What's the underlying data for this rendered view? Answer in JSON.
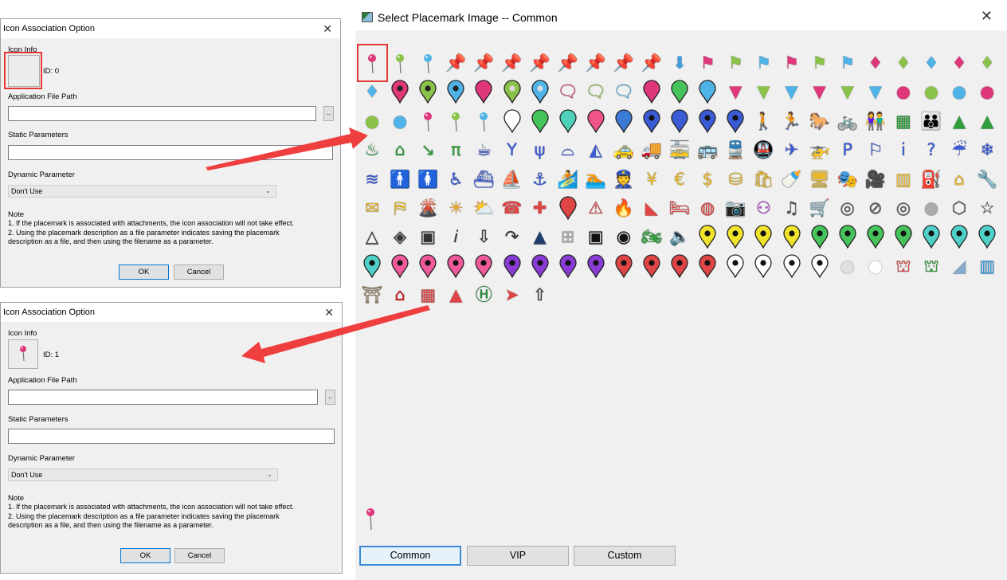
{
  "dialog_top": {
    "title": "Icon Association Option",
    "icon_info_label": "Icon Info",
    "id_text": "ID: 0",
    "app_path_label": "Application File Path",
    "browse_label": "..",
    "static_params_label": "Static Parameters",
    "dynamic_param_label": "Dynamic Parameter",
    "dynamic_param_value": "Don't Use",
    "note_title": "Note",
    "note_text": "1. If the placemark is associated with attachments, the icon association will not take effect.\n2. Using the placemark description as a file parameter indicates saving the placemark\ndescription as a file, and then using the filename as a parameter.",
    "ok_label": "OK",
    "cancel_label": "Cancel"
  },
  "dialog_bottom": {
    "title": "Icon Association Option",
    "icon_info_label": "Icon Info",
    "id_text": "ID: 1",
    "app_path_label": "Application File Path",
    "browse_label": "..",
    "static_params_label": "Static Parameters",
    "dynamic_param_label": "Dynamic Parameter",
    "dynamic_param_value": "Don't Use",
    "note_title": "Note",
    "note_text": "1. If the placemark is associated with attachments, the icon association will not take effect.\n2. Using the placemark description as a file parameter indicates saving the placemark\ndescription as a file, and then using the filename as a parameter.",
    "ok_label": "OK",
    "cancel_label": "Cancel"
  },
  "picker": {
    "title": "Select Placemark Image -- Common",
    "tabs": [
      {
        "label": "Common",
        "active": true
      },
      {
        "label": "VIP",
        "active": false
      },
      {
        "label": "Custom",
        "active": false
      }
    ],
    "icons": [
      {
        "kind": "pin",
        "color": "#e0367a"
      },
      {
        "kind": "pin",
        "color": "#8bc34a"
      },
      {
        "kind": "pin",
        "color": "#4fb3e8"
      },
      {
        "kind": "glyph",
        "glyph": "📌",
        "color": "#e8e02a"
      },
      {
        "kind": "glyph",
        "glyph": "📌",
        "color": "#3b5bd6"
      },
      {
        "kind": "glyph",
        "glyph": "📌",
        "color": "#46c35a"
      },
      {
        "kind": "glyph",
        "glyph": "📌",
        "color": "#2cc0b9"
      },
      {
        "kind": "glyph",
        "glyph": "📌",
        "color": "#d13a8f"
      },
      {
        "kind": "glyph",
        "glyph": "📌",
        "color": "#8a3bd6"
      },
      {
        "kind": "glyph",
        "glyph": "📌",
        "color": "#e04545"
      },
      {
        "kind": "glyph",
        "glyph": "📌",
        "color": "#dddddd"
      },
      {
        "kind": "glyph",
        "glyph": "⬇",
        "color": "#3aa0e0"
      },
      {
        "kind": "glyph",
        "glyph": "⚑",
        "color": "#e0367a"
      },
      {
        "kind": "glyph",
        "glyph": "⚑",
        "color": "#8bc34a"
      },
      {
        "kind": "glyph",
        "glyph": "⚑",
        "color": "#4fb3e8"
      },
      {
        "kind": "glyph",
        "glyph": "⚑",
        "color": "#e0367a"
      },
      {
        "kind": "glyph",
        "glyph": "⚑",
        "color": "#8bc34a"
      },
      {
        "kind": "glyph",
        "glyph": "⚑",
        "color": "#4fb3e8"
      },
      {
        "kind": "glyph",
        "glyph": "♦",
        "color": "#e0367a"
      },
      {
        "kind": "glyph",
        "glyph": "♦",
        "color": "#8bc34a"
      },
      {
        "kind": "glyph",
        "glyph": "♦",
        "color": "#4fb3e8"
      },
      {
        "kind": "glyph",
        "glyph": "♦",
        "color": "#e0367a"
      },
      {
        "kind": "glyph",
        "glyph": "♦",
        "color": "#8bc34a"
      },
      {
        "kind": "glyph",
        "glyph": "♦",
        "color": "#4fb3e8"
      },
      {
        "kind": "balloon",
        "color": "#e0367a",
        "dot": "#222"
      },
      {
        "kind": "balloon",
        "color": "#8bc34a",
        "dot": "#222"
      },
      {
        "kind": "balloon",
        "color": "#4fb3e8",
        "dot": "#222"
      },
      {
        "kind": "balloon",
        "color": "#e0367a",
        "dot": "#e0367a"
      },
      {
        "kind": "balloon",
        "color": "#8bc34a",
        "dot": "#ddd"
      },
      {
        "kind": "balloon",
        "color": "#4fb3e8",
        "dot": "#ddd"
      },
      {
        "kind": "glyph",
        "glyph": "🗨",
        "color": "#e0367a"
      },
      {
        "kind": "glyph",
        "glyph": "🗨",
        "color": "#8bc34a"
      },
      {
        "kind": "glyph",
        "glyph": "🗨",
        "color": "#4fb3e8"
      },
      {
        "kind": "balloon",
        "color": "#e0367a",
        "dot": "#e0367a"
      },
      {
        "kind": "balloon",
        "color": "#46c35a",
        "dot": "#46c35a"
      },
      {
        "kind": "balloon",
        "color": "#4fb3e8",
        "dot": "#4fb3e8"
      },
      {
        "kind": "glyph",
        "glyph": "▼",
        "color": "#e0367a"
      },
      {
        "kind": "glyph",
        "glyph": "▼",
        "color": "#8bc34a"
      },
      {
        "kind": "glyph",
        "glyph": "▼",
        "color": "#4fb3e8"
      },
      {
        "kind": "glyph",
        "glyph": "▼",
        "color": "#e0367a"
      },
      {
        "kind": "glyph",
        "glyph": "▼",
        "color": "#8bc34a"
      },
      {
        "kind": "glyph",
        "glyph": "▼",
        "color": "#4fb3e8"
      },
      {
        "kind": "glyph",
        "glyph": "●",
        "color": "#e0367a"
      },
      {
        "kind": "glyph",
        "glyph": "●",
        "color": "#8bc34a"
      },
      {
        "kind": "glyph",
        "glyph": "●",
        "color": "#4fb3e8"
      },
      {
        "kind": "glyph",
        "glyph": "●",
        "color": "#e0367a"
      },
      {
        "kind": "glyph",
        "glyph": "●",
        "color": "#8bc34a"
      },
      {
        "kind": "glyph",
        "glyph": "●",
        "color": "#4fb3e8"
      },
      {
        "kind": "pin",
        "color": "#e0367a"
      },
      {
        "kind": "pin",
        "color": "#8bc34a"
      },
      {
        "kind": "pin",
        "color": "#4fb3e8"
      },
      {
        "kind": "balloon",
        "color": "#ffffff",
        "dot": "#ffffff"
      },
      {
        "kind": "balloon",
        "color": "#46c35a",
        "dot": "#46c35a"
      },
      {
        "kind": "balloon",
        "color": "#4fd1b9",
        "dot": "#4fd1b9"
      },
      {
        "kind": "balloon",
        "color": "#f0528a",
        "dot": "#f0528a"
      },
      {
        "kind": "balloon",
        "color": "#3b7bd6",
        "dot": "#3b7bd6"
      },
      {
        "kind": "balloon",
        "color": "#3b5bd6",
        "dot": "#111"
      },
      {
        "kind": "balloon",
        "color": "#3b5bd6",
        "dot": "#3b5bd6"
      },
      {
        "kind": "balloon",
        "color": "#3b5bd6",
        "dot": "#111"
      },
      {
        "kind": "balloon",
        "color": "#3b5bd6",
        "dot": "#111"
      },
      {
        "kind": "glyph",
        "glyph": "🚶",
        "color": "#2e9d3a"
      },
      {
        "kind": "glyph",
        "glyph": "🏃",
        "color": "#2e9d3a"
      },
      {
        "kind": "glyph",
        "glyph": "🐎",
        "color": "#2e9d3a"
      },
      {
        "kind": "glyph",
        "glyph": "🚲",
        "color": "#2e9d3a"
      },
      {
        "kind": "glyph",
        "glyph": "👫",
        "color": "#2e9d3a"
      },
      {
        "kind": "glyph",
        "glyph": "▦",
        "color": "#2e9d3a"
      },
      {
        "kind": "glyph",
        "glyph": "👪",
        "color": "#2e9d3a"
      },
      {
        "kind": "glyph",
        "glyph": "▲",
        "color": "#2e9d3a"
      },
      {
        "kind": "glyph",
        "glyph": "▲",
        "color": "#2e9d3a"
      },
      {
        "kind": "glyph",
        "glyph": "♨",
        "color": "#2e9d3a"
      },
      {
        "kind": "glyph",
        "glyph": "⌂",
        "color": "#2e9d3a"
      },
      {
        "kind": "glyph",
        "glyph": "↘",
        "color": "#2e9d3a"
      },
      {
        "kind": "glyph",
        "glyph": "π",
        "color": "#2e9d3a"
      },
      {
        "kind": "glyph",
        "glyph": "☕",
        "color": "#3b5bd6"
      },
      {
        "kind": "glyph",
        "glyph": "Y",
        "color": "#3b5bd6"
      },
      {
        "kind": "glyph",
        "glyph": "ψ",
        "color": "#3b5bd6"
      },
      {
        "kind": "glyph",
        "glyph": "⌓",
        "color": "#3b5bd6"
      },
      {
        "kind": "glyph",
        "glyph": "◭",
        "color": "#3b5bd6"
      },
      {
        "kind": "glyph",
        "glyph": "🚕",
        "color": "#3b5bd6"
      },
      {
        "kind": "glyph",
        "glyph": "🚚",
        "color": "#3b5bd6"
      },
      {
        "kind": "glyph",
        "glyph": "🚋",
        "color": "#3b5bd6"
      },
      {
        "kind": "glyph",
        "glyph": "🚌",
        "color": "#3b5bd6"
      },
      {
        "kind": "glyph",
        "glyph": "🚆",
        "color": "#3b5bd6"
      },
      {
        "kind": "glyph",
        "glyph": "🚇",
        "color": "#3b5bd6"
      },
      {
        "kind": "glyph",
        "glyph": "✈",
        "color": "#3b5bd6"
      },
      {
        "kind": "glyph",
        "glyph": "🚁",
        "color": "#3b5bd6"
      },
      {
        "kind": "glyph",
        "glyph": "P",
        "color": "#3b5bd6"
      },
      {
        "kind": "glyph",
        "glyph": "⚐",
        "color": "#3b5bd6"
      },
      {
        "kind": "glyph",
        "glyph": "i",
        "color": "#3b5bd6"
      },
      {
        "kind": "glyph",
        "glyph": "?",
        "color": "#3b5bd6"
      },
      {
        "kind": "glyph",
        "glyph": "☔",
        "color": "#3b5bd6"
      },
      {
        "kind": "glyph",
        "glyph": "❄",
        "color": "#3b5bd6"
      },
      {
        "kind": "glyph",
        "glyph": "≋",
        "color": "#3b5bd6"
      },
      {
        "kind": "glyph",
        "glyph": "🚹",
        "color": "#3b5bd6"
      },
      {
        "kind": "glyph",
        "glyph": "🚺",
        "color": "#3b5bd6"
      },
      {
        "kind": "glyph",
        "glyph": "♿",
        "color": "#3b5bd6"
      },
      {
        "kind": "glyph",
        "glyph": "⛴",
        "color": "#3b5bd6"
      },
      {
        "kind": "glyph",
        "glyph": "⛵",
        "color": "#3b5bd6"
      },
      {
        "kind": "glyph",
        "glyph": "⚓",
        "color": "#3b5bd6"
      },
      {
        "kind": "glyph",
        "glyph": "🏄",
        "color": "#3b5bd6"
      },
      {
        "kind": "glyph",
        "glyph": "🏊",
        "color": "#3b5bd6"
      },
      {
        "kind": "glyph",
        "glyph": "👮",
        "color": "#e8b82a"
      },
      {
        "kind": "glyph",
        "glyph": "¥",
        "color": "#e8b82a"
      },
      {
        "kind": "glyph",
        "glyph": "€",
        "color": "#e8b82a"
      },
      {
        "kind": "glyph",
        "glyph": "$",
        "color": "#e8b82a"
      },
      {
        "kind": "glyph",
        "glyph": "⛁",
        "color": "#e8b82a"
      },
      {
        "kind": "glyph",
        "glyph": "🛍",
        "color": "#e8b82a"
      },
      {
        "kind": "glyph",
        "glyph": "🍼",
        "color": "#e8b82a"
      },
      {
        "kind": "glyph",
        "glyph": "🖥",
        "color": "#e8b82a"
      },
      {
        "kind": "glyph",
        "glyph": "🎭",
        "color": "#e8b82a"
      },
      {
        "kind": "glyph",
        "glyph": "🎥",
        "color": "#e8b82a"
      },
      {
        "kind": "glyph",
        "glyph": "▥",
        "color": "#e8b82a"
      },
      {
        "kind": "glyph",
        "glyph": "⛽",
        "color": "#e8b82a"
      },
      {
        "kind": "glyph",
        "glyph": "⌂",
        "color": "#e8b82a"
      },
      {
        "kind": "glyph",
        "glyph": "🔧",
        "color": "#e8b82a"
      },
      {
        "kind": "glyph",
        "glyph": "✉",
        "color": "#e8b82a"
      },
      {
        "kind": "glyph",
        "glyph": "⛿",
        "color": "#e8b82a"
      },
      {
        "kind": "glyph",
        "glyph": "🌋",
        "color": "#e85a2a"
      },
      {
        "kind": "glyph",
        "glyph": "☀",
        "color": "#e8a82a"
      },
      {
        "kind": "glyph",
        "glyph": "⛅",
        "color": "#e8a82a"
      },
      {
        "kind": "glyph",
        "glyph": "☎",
        "color": "#e04545"
      },
      {
        "kind": "glyph",
        "glyph": "✚",
        "color": "#e04545"
      },
      {
        "kind": "balloon",
        "color": "#e04545",
        "dot": "#e04545"
      },
      {
        "kind": "glyph",
        "glyph": "⚠",
        "color": "#e04545"
      },
      {
        "kind": "glyph",
        "glyph": "🔥",
        "color": "#e04545"
      },
      {
        "kind": "glyph",
        "glyph": "◣",
        "color": "#e04545"
      },
      {
        "kind": "glyph",
        "glyph": "🛏",
        "color": "#e04545"
      },
      {
        "kind": "glyph",
        "glyph": "◍",
        "color": "#e04545"
      },
      {
        "kind": "glyph",
        "glyph": "📷",
        "color": "#b03bd6"
      },
      {
        "kind": "glyph",
        "glyph": "⚇",
        "color": "#b03bd6"
      },
      {
        "kind": "glyph",
        "glyph": "♫",
        "color": "#555555"
      },
      {
        "kind": "glyph",
        "glyph": "🛒",
        "color": "#555555"
      },
      {
        "kind": "glyph",
        "glyph": "◎",
        "color": "#555555"
      },
      {
        "kind": "glyph",
        "glyph": "⊘",
        "color": "#555555"
      },
      {
        "kind": "glyph",
        "glyph": "◎",
        "color": "#555555"
      },
      {
        "kind": "glyph",
        "glyph": "●",
        "color": "#aaaaaa"
      },
      {
        "kind": "glyph",
        "glyph": "⬡",
        "color": "#555555"
      },
      {
        "kind": "glyph",
        "glyph": "☆",
        "color": "#555555"
      },
      {
        "kind": "glyph",
        "glyph": "△",
        "color": "#333333"
      },
      {
        "kind": "glyph",
        "glyph": "◈",
        "color": "#333333"
      },
      {
        "kind": "glyph",
        "glyph": "▣",
        "color": "#333333"
      },
      {
        "kind": "glyph",
        "glyph": "𝑖",
        "color": "#333333"
      },
      {
        "kind": "glyph",
        "glyph": "⇩",
        "color": "#333333"
      },
      {
        "kind": "glyph",
        "glyph": "↷",
        "color": "#333333"
      },
      {
        "kind": "glyph",
        "glyph": "▲",
        "color": "#1e3d6b"
      },
      {
        "kind": "glyph",
        "glyph": "⊞",
        "color": "#aaaaaa"
      },
      {
        "kind": "glyph",
        "glyph": "▣",
        "color": "#111111"
      },
      {
        "kind": "glyph",
        "glyph": "◉",
        "color": "#111111"
      },
      {
        "kind": "glyph",
        "glyph": "🏍",
        "color": "#2e9d3a"
      },
      {
        "kind": "glyph",
        "glyph": "🔈",
        "color": "#333333"
      },
      {
        "kind": "balloon",
        "color": "#f0e42a",
        "dot": "#111"
      },
      {
        "kind": "balloon",
        "color": "#f0e42a",
        "dot": "#111"
      },
      {
        "kind": "balloon",
        "color": "#f0e42a",
        "dot": "#111"
      },
      {
        "kind": "balloon",
        "color": "#f0e42a",
        "dot": "#111"
      },
      {
        "kind": "balloon",
        "color": "#46c35a",
        "dot": "#111"
      },
      {
        "kind": "balloon",
        "color": "#46c35a",
        "dot": "#111"
      },
      {
        "kind": "balloon",
        "color": "#46c35a",
        "dot": "#111"
      },
      {
        "kind": "balloon",
        "color": "#46c35a",
        "dot": "#111"
      },
      {
        "kind": "balloon",
        "color": "#4fd1c9",
        "dot": "#111"
      },
      {
        "kind": "balloon",
        "color": "#4fd1c9",
        "dot": "#111"
      },
      {
        "kind": "balloon",
        "color": "#4fd1c9",
        "dot": "#111"
      },
      {
        "kind": "balloon",
        "color": "#4fd1c9",
        "dot": "#111"
      },
      {
        "kind": "balloon",
        "color": "#f05a9a",
        "dot": "#111"
      },
      {
        "kind": "balloon",
        "color": "#f05a9a",
        "dot": "#111"
      },
      {
        "kind": "balloon",
        "color": "#f05a9a",
        "dot": "#111"
      },
      {
        "kind": "balloon",
        "color": "#f05a9a",
        "dot": "#111"
      },
      {
        "kind": "balloon",
        "color": "#8a3bd6",
        "dot": "#111"
      },
      {
        "kind": "balloon",
        "color": "#8a3bd6",
        "dot": "#111"
      },
      {
        "kind": "balloon",
        "color": "#8a3bd6",
        "dot": "#111"
      },
      {
        "kind": "balloon",
        "color": "#8a3bd6",
        "dot": "#111"
      },
      {
        "kind": "balloon",
        "color": "#e04545",
        "dot": "#111"
      },
      {
        "kind": "balloon",
        "color": "#e04545",
        "dot": "#111"
      },
      {
        "kind": "balloon",
        "color": "#e04545",
        "dot": "#111"
      },
      {
        "kind": "balloon",
        "color": "#e04545",
        "dot": "#111"
      },
      {
        "kind": "balloon",
        "color": "#ffffff",
        "dot": "#111"
      },
      {
        "kind": "balloon",
        "color": "#ffffff",
        "dot": "#111"
      },
      {
        "kind": "balloon",
        "color": "#ffffff",
        "dot": "#111"
      },
      {
        "kind": "balloon",
        "color": "#ffffff",
        "dot": "#111"
      },
      {
        "kind": "glyph",
        "glyph": "●",
        "color": "#e0e0e0"
      },
      {
        "kind": "glyph",
        "glyph": "●",
        "color": "#ffffff"
      },
      {
        "kind": "glyph",
        "glyph": "⛫",
        "color": "#e04545"
      },
      {
        "kind": "glyph",
        "glyph": "⛫",
        "color": "#2e9d3a"
      },
      {
        "kind": "glyph",
        "glyph": "◢",
        "color": "#88aacc"
      },
      {
        "kind": "glyph",
        "glyph": "▥",
        "color": "#3aa0e0"
      },
      {
        "kind": "glyph",
        "glyph": "⛩",
        "color": "#8a7a5a"
      },
      {
        "kind": "glyph",
        "glyph": "⌂",
        "color": "#d01c1c"
      },
      {
        "kind": "glyph",
        "glyph": "▦",
        "color": "#e04545"
      },
      {
        "kind": "glyph",
        "glyph": "▲",
        "color": "#e04545"
      },
      {
        "kind": "glyph",
        "glyph": "Ⓗ",
        "color": "#1e8a2e"
      },
      {
        "kind": "glyph",
        "glyph": "➤",
        "color": "#e04545"
      },
      {
        "kind": "glyph",
        "glyph": "⇧",
        "color": "#333333"
      }
    ],
    "selected_index": 0
  }
}
